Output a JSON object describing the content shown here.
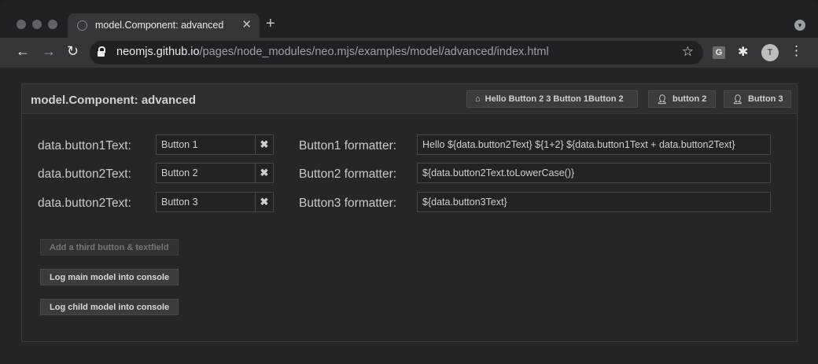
{
  "browser": {
    "tab_title": "model.Component: advanced",
    "tab_close": "✕",
    "new_tab": "+",
    "url_host": "neomjs.github.io",
    "url_path": "/pages/node_modules/neo.mjs/examples/model/advanced/index.html",
    "extension_letter": "G",
    "profile_initial": "T"
  },
  "panel": {
    "title": "model.Component: advanced",
    "header_buttons": [
      {
        "icon": "home-icon",
        "label": "Hello Button 2 3 Button 1Button 2"
      },
      {
        "icon": "user-icon",
        "label": "button 2"
      },
      {
        "icon": "user-icon",
        "label": "Button 3"
      }
    ]
  },
  "form": {
    "rows": [
      {
        "label": "data.button1Text:",
        "value": "Button 1",
        "formatter_label": "Button1 formatter:",
        "formatter_value": "Hello ${data.button2Text} ${1+2} ${data.button1Text + data.button2Text}"
      },
      {
        "label": "data.button2Text:",
        "value": "Button 2",
        "formatter_label": "Button2 formatter:",
        "formatter_value": "${data.button2Text.toLowerCase()}"
      },
      {
        "label": "data.button2Text:",
        "value": "Button 3",
        "formatter_label": "Button3 formatter:",
        "formatter_value": "${data.button3Text}"
      }
    ],
    "clear_glyph": "✖"
  },
  "actions": [
    {
      "label": "Add a third button & textfield",
      "disabled": true
    },
    {
      "label": "Log main model into console",
      "disabled": false
    },
    {
      "label": "Log child model into console",
      "disabled": false
    }
  ]
}
